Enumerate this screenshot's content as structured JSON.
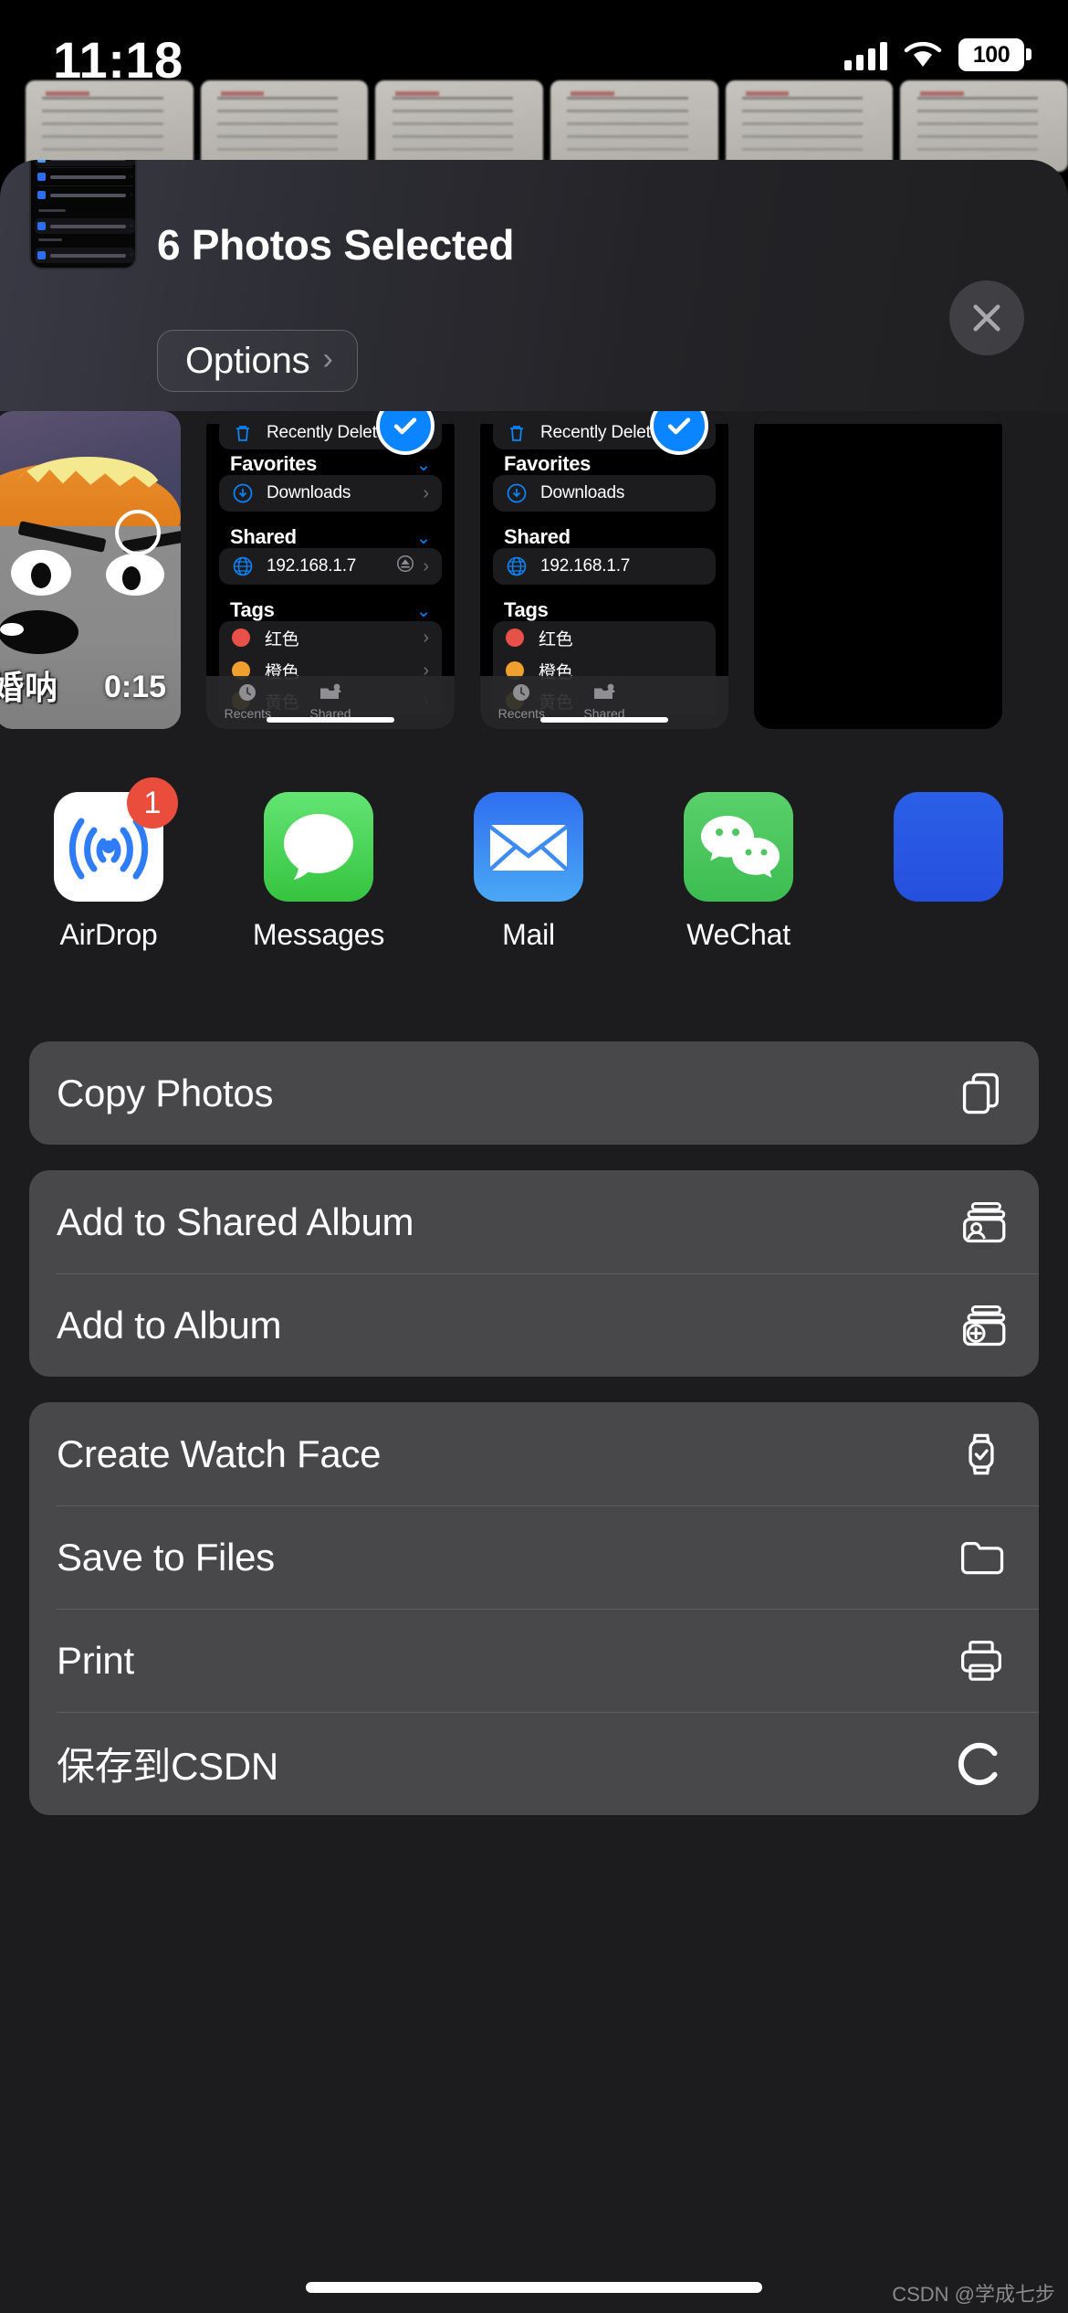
{
  "status_bar": {
    "time": "11:18",
    "battery_percent": "100",
    "signal_icon": "cellular-signal-icon",
    "wifi_icon": "wifi-icon",
    "battery_icon": "battery-icon"
  },
  "share_sheet": {
    "title": "6 Photos Selected",
    "options_label": "Options",
    "options_chevron": "›",
    "close_icon": "close-icon",
    "thumbnail_stack_name": "selection-thumbnail-stack"
  },
  "previews": {
    "video": {
      "caption": "婚呐",
      "duration": "0:15"
    },
    "files_screenshot": {
      "top_item": "Recently Deleted",
      "sections": [
        {
          "title": "Favorites",
          "items": [
            {
              "label": "Downloads",
              "icon": "download-circle-icon"
            }
          ]
        },
        {
          "title": "Shared",
          "items": [
            {
              "label": "192.168.1.7",
              "icon": "globe-icon",
              "accessory": "eject-icon"
            }
          ]
        },
        {
          "title": "Tags",
          "items": [
            {
              "label": "红色",
              "color": "#e8504a"
            },
            {
              "label": "橙色",
              "color": "#f0a02e"
            },
            {
              "label": "黄色",
              "color": "#f2d33c"
            }
          ]
        }
      ],
      "tabs": [
        {
          "label": "Recents",
          "icon": "clock-icon"
        },
        {
          "label": "Shared",
          "icon": "shared-folder-icon"
        }
      ],
      "selected_badge": "checkmark-icon"
    }
  },
  "apps": [
    {
      "name": "AirDrop",
      "icon": "airdrop-icon",
      "badge": "1"
    },
    {
      "name": "Messages",
      "icon": "messages-icon",
      "badge": ""
    },
    {
      "name": "Mail",
      "icon": "mail-icon",
      "badge": ""
    },
    {
      "name": "WeChat",
      "icon": "wechat-icon",
      "badge": ""
    },
    {
      "name": "",
      "icon": "partial-blue-app-icon",
      "badge": ""
    }
  ],
  "action_groups": [
    {
      "actions": [
        {
          "label": "Copy Photos",
          "icon": "copy-icon"
        }
      ]
    },
    {
      "actions": [
        {
          "label": "Add to Shared Album",
          "icon": "shared-album-icon"
        },
        {
          "label": "Add to Album",
          "icon": "add-album-icon"
        }
      ]
    },
    {
      "actions": [
        {
          "label": "Create Watch Face",
          "icon": "watch-icon"
        },
        {
          "label": "Save to Files",
          "icon": "folder-icon"
        },
        {
          "label": "Print",
          "icon": "printer-icon"
        },
        {
          "label": "保存到CSDN",
          "icon": "csdn-icon"
        }
      ]
    }
  ],
  "watermark": "CSDN @学成七步",
  "colors": {
    "accent_blue": "#0a84ff",
    "sheet_bg": "#1c1c1e",
    "row_bg": "#48484a",
    "badge_red": "#eb4d3d",
    "messages_green": "#4cd464",
    "wechat_green": "#4cc85e",
    "mail_blue": "#2f7df6"
  }
}
